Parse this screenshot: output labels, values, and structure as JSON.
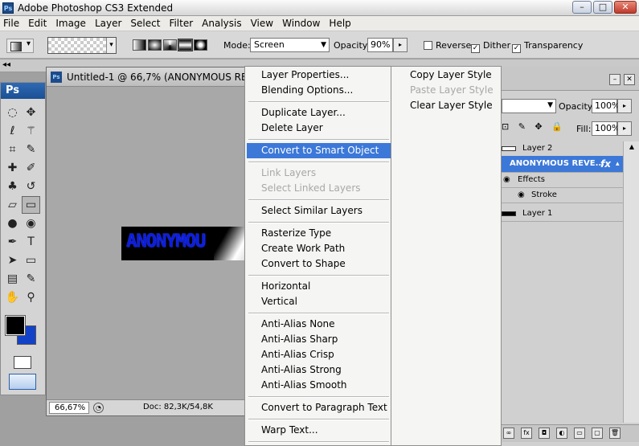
{
  "window": {
    "title": "Adobe Photoshop CS3 Extended",
    "logo_text": "Ps",
    "minimize": "–",
    "maximize": "□",
    "close": "✕"
  },
  "menubar": [
    "File",
    "Edit",
    "Image",
    "Layer",
    "Select",
    "Filter",
    "Analysis",
    "View",
    "Window",
    "Help"
  ],
  "options": {
    "mode_label": "Mode:",
    "mode_value": "Screen",
    "opacity_label": "Opacity:",
    "opacity_value": "90%",
    "reverse_label": "Reverse",
    "reverse_checked": false,
    "dither_label": "Dither",
    "dither_checked": true,
    "transparency_label": "Transparency",
    "transparency_checked": true,
    "arrow": "▸"
  },
  "toolbox": {
    "header": "Ps",
    "foreground_color": "#000000",
    "background_color": "#1242c8",
    "tools": [
      {
        "name": "marquee-tool-icon",
        "glyph": "◌"
      },
      {
        "name": "move-tool-icon",
        "glyph": "✥"
      },
      {
        "name": "lasso-tool-icon",
        "glyph": "ℓ"
      },
      {
        "name": "magic-wand-icon",
        "glyph": "⚚"
      },
      {
        "name": "crop-tool-icon",
        "glyph": "⌗"
      },
      {
        "name": "eyedropper-icon",
        "glyph": "✎"
      },
      {
        "name": "healing-brush-icon",
        "glyph": "✚"
      },
      {
        "name": "brush-tool-icon",
        "glyph": "✐"
      },
      {
        "name": "clone-stamp-icon",
        "glyph": "♣"
      },
      {
        "name": "history-brush-icon",
        "glyph": "↺"
      },
      {
        "name": "eraser-tool-icon",
        "glyph": "▱"
      },
      {
        "name": "gradient-tool-icon",
        "glyph": "▭"
      },
      {
        "name": "blur-tool-icon",
        "glyph": "●"
      },
      {
        "name": "dodge-tool-icon",
        "glyph": "◉"
      },
      {
        "name": "pen-tool-icon",
        "glyph": "✒"
      },
      {
        "name": "type-tool-icon",
        "glyph": "T"
      },
      {
        "name": "path-select-icon",
        "glyph": "➤"
      },
      {
        "name": "shape-tool-icon",
        "glyph": "▭"
      },
      {
        "name": "notes-tool-icon",
        "glyph": "▤"
      },
      {
        "name": "eyedropper2-icon",
        "glyph": "✎"
      },
      {
        "name": "hand-tool-icon",
        "glyph": "✋"
      },
      {
        "name": "zoom-tool-icon",
        "glyph": "⚲"
      }
    ]
  },
  "document": {
    "title": "Untitled-1 @ 66,7% (ANONYMOUS REVEN",
    "logo_text": "Ps",
    "canvas_text": "ANONYMOU",
    "zoom": "66,67%",
    "doc_info": "Doc: 82,3K/54,8K"
  },
  "context_menu": {
    "items": [
      {
        "label": "Layer Properties...",
        "disabled": false,
        "highlighted": false
      },
      {
        "label": "Blending Options...",
        "disabled": false,
        "highlighted": false
      },
      {
        "label": "Duplicate Layer...",
        "disabled": false,
        "highlighted": false
      },
      {
        "label": "Delete Layer",
        "disabled": false,
        "highlighted": false
      },
      {
        "label": "Convert to Smart Object",
        "disabled": false,
        "highlighted": true
      },
      {
        "label": "Link Layers",
        "disabled": true,
        "highlighted": false
      },
      {
        "label": "Select Linked Layers",
        "disabled": true,
        "highlighted": false
      },
      {
        "label": "Select Similar Layers",
        "disabled": false,
        "highlighted": false
      },
      {
        "label": "Rasterize Type",
        "disabled": false,
        "highlighted": false
      },
      {
        "label": "Create Work Path",
        "disabled": false,
        "highlighted": false
      },
      {
        "label": "Convert to Shape",
        "disabled": false,
        "highlighted": false
      },
      {
        "label": "Horizontal",
        "disabled": false,
        "highlighted": false
      },
      {
        "label": "Vertical",
        "disabled": false,
        "highlighted": false
      },
      {
        "label": "Anti-Alias None",
        "disabled": false,
        "highlighted": false
      },
      {
        "label": "Anti-Alias Sharp",
        "disabled": false,
        "highlighted": false
      },
      {
        "label": "Anti-Alias Crisp",
        "disabled": false,
        "highlighted": false
      },
      {
        "label": "Anti-Alias Strong",
        "disabled": false,
        "highlighted": false
      },
      {
        "label": "Anti-Alias Smooth",
        "disabled": false,
        "highlighted": false
      },
      {
        "label": "Convert to Paragraph Text",
        "disabled": false,
        "highlighted": false
      },
      {
        "label": "Warp Text...",
        "disabled": false,
        "highlighted": false
      }
    ],
    "submenu": [
      {
        "label": "Copy Layer Style",
        "disabled": false
      },
      {
        "label": "Paste Layer Style",
        "disabled": true
      },
      {
        "label": "Clear Layer Style",
        "disabled": false
      }
    ]
  },
  "layers_panel": {
    "opacity_label": "Opacity:",
    "opacity_value": "100%",
    "fill_label": "Fill:",
    "fill_value": "100%",
    "lock_icons": "⊡ ✎ ✥ 🔒",
    "layers": [
      {
        "name": "Layer 2",
        "selected": false,
        "thumb": "white"
      },
      {
        "name": "ANONYMOUS REVE...",
        "selected": true,
        "fx": "fx",
        "arrow": "▴"
      },
      {
        "name": "Effects",
        "selected": false,
        "sub": true
      },
      {
        "name": "Stroke",
        "selected": false,
        "sub2": true
      },
      {
        "name": "Layer 1",
        "selected": false,
        "thumb": "black"
      }
    ],
    "eye_glyph": "👁"
  }
}
